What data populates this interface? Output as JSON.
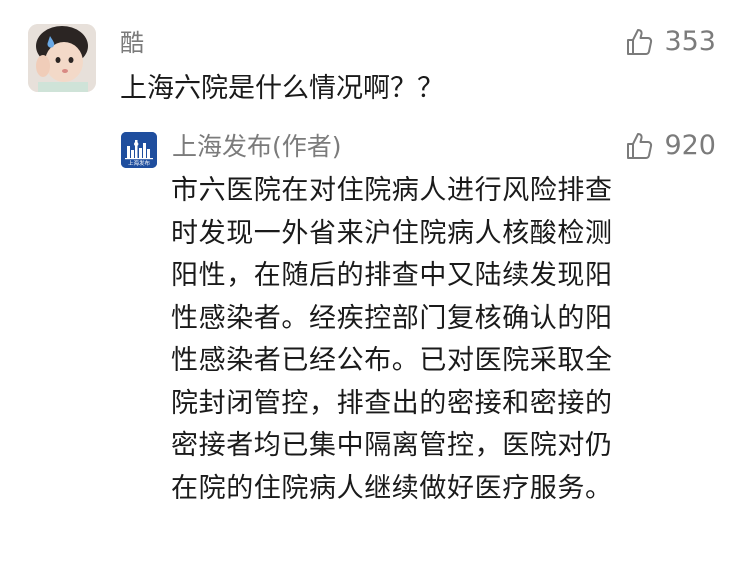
{
  "comment": {
    "username": "酷",
    "likes": "353",
    "text": "上海六院是什么情况啊？？",
    "avatar_icon": "child-photo-avatar"
  },
  "reply": {
    "author": "上海发布(作者)",
    "likes": "920",
    "avatar_icon": "shanghai-fabu-logo",
    "avatar_logo_text": "上海发布",
    "lines": [
      "市六医院在对住院病人进行风险排查",
      "时发现一外省来沪住院病人核酸检测",
      "阳性，在随后的排查中又陆续发现阳",
      "性感染者。经疾控部门复核确认的阳",
      "性感染者已经公布。已对医院采取全",
      "院封闭管控，排查出的密接和密接的",
      "密接者均已集中隔离管控，医院对仍",
      "在院的住院病人继续做好医疗服务。"
    ]
  },
  "colors": {
    "text_primary": "#1a1a1a",
    "text_secondary": "#7b7b7b",
    "logo_blue": "#1f4e9e"
  }
}
